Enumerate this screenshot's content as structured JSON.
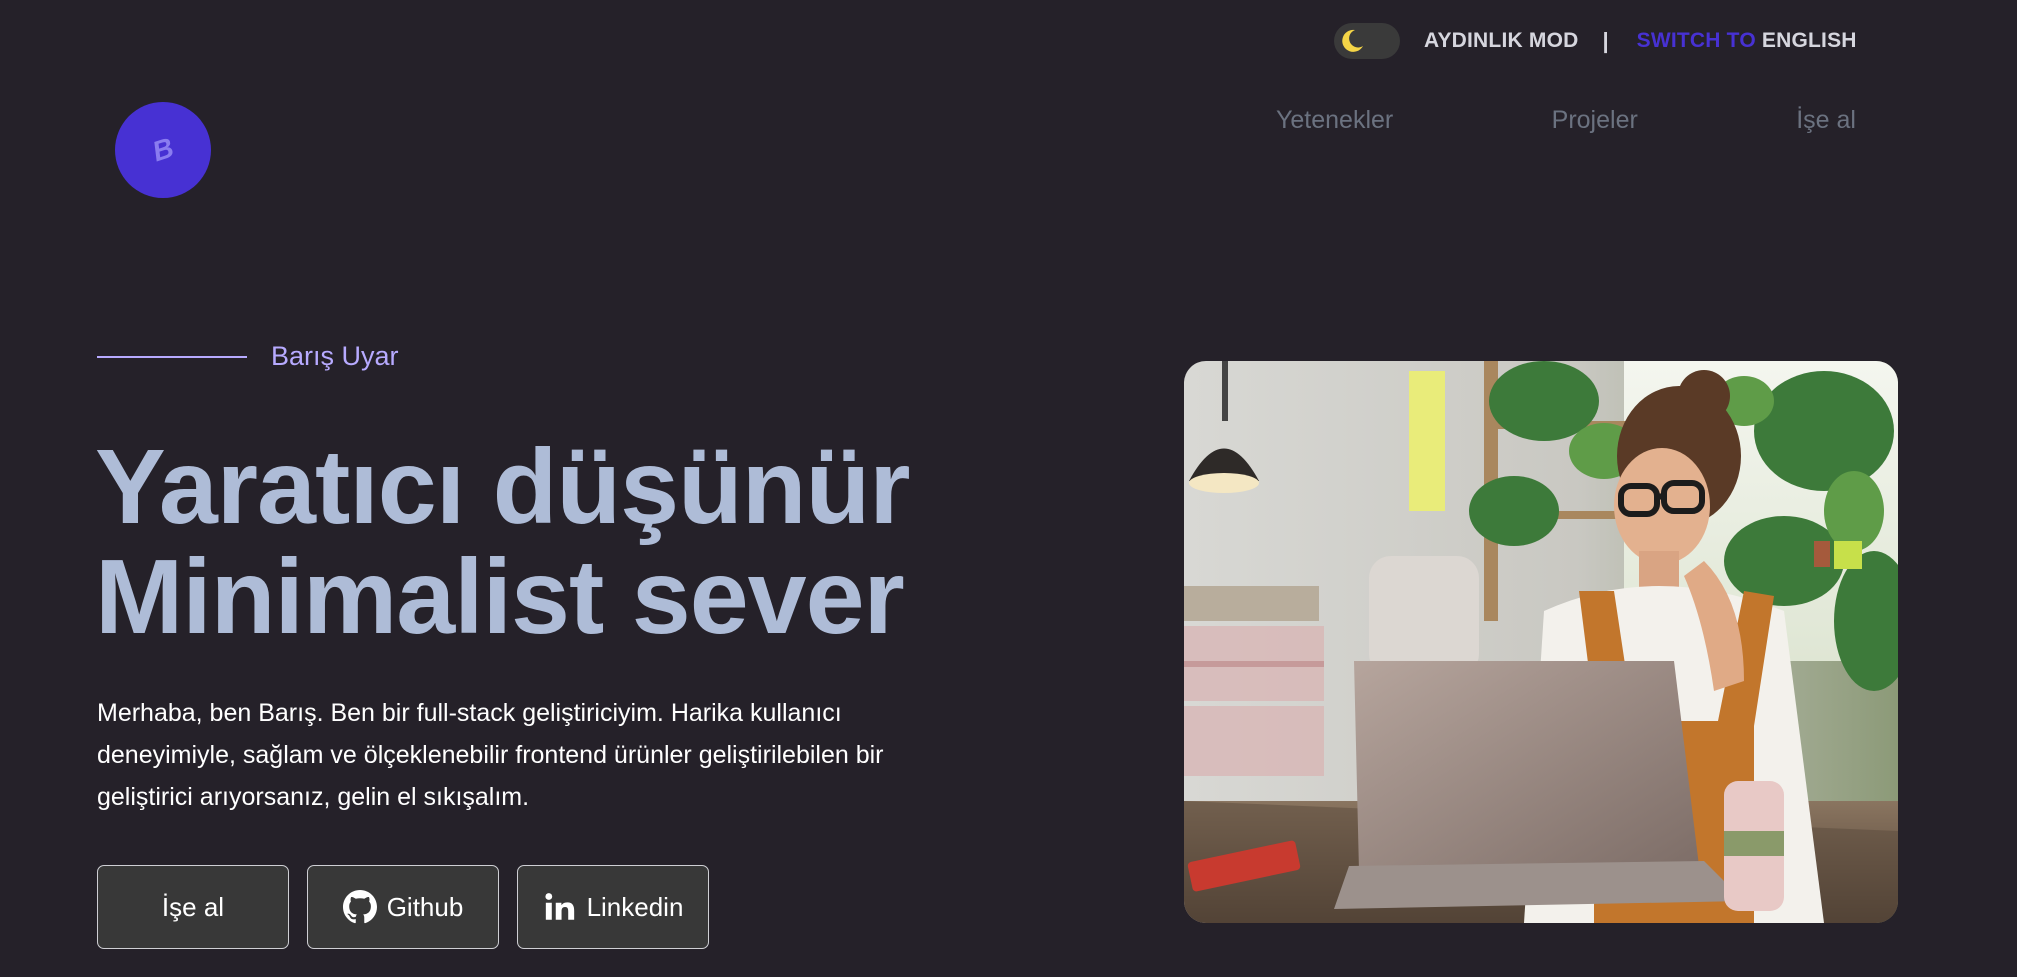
{
  "topbar": {
    "toggle_icon": "moon-icon",
    "mode_label": "AYDINLIK MOD",
    "divider": "|",
    "lang_prefix": "SWITCH TO",
    "lang_name": "ENGLISH",
    "accent_color": "#4731d3"
  },
  "logo": {
    "letter": "B",
    "background": "#4731d3"
  },
  "nav": {
    "items": [
      {
        "label": "Yetenekler"
      },
      {
        "label": "Projeler"
      },
      {
        "label": "İşe al"
      }
    ]
  },
  "hero": {
    "name": "Barış Uyar",
    "headline_line1": "Yaratıcı düşünür",
    "headline_line2": "Minimalist sever",
    "intro": "Merhaba, ben Barış. Ben bir full-stack geliştiriciyim. Harika kullanıcı deneyimiyle, sağlam ve ölçeklenebilir frontend ürünler geliştirilebilen bir geliştirici arıyorsanız, gelin el sıkışalım.",
    "buttons": {
      "hire": "İşe al",
      "github": "Github",
      "linkedin": "Linkedin"
    },
    "photo_subject": "woman-with-laptop-photo"
  },
  "colors": {
    "background": "#252129",
    "headline": "#aebcd7",
    "name_accent": "#b7aaff"
  }
}
